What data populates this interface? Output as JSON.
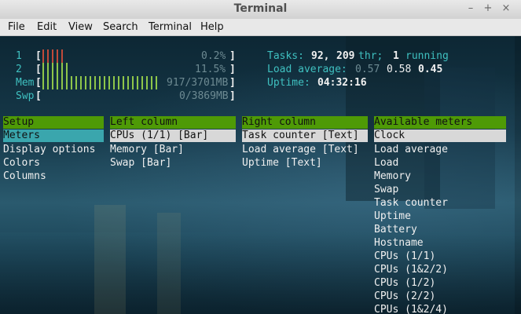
{
  "window": {
    "title": "Terminal",
    "controls": [
      "–",
      "+",
      "×"
    ]
  },
  "menu": [
    "File",
    "Edit",
    "View",
    "Search",
    "Terminal",
    "Help"
  ],
  "meters": {
    "cpu1": {
      "label": "1",
      "value": "0.2%"
    },
    "cpu2": {
      "label": "2",
      "value": "11.5%"
    },
    "mem": {
      "label": "Mem",
      "value": "917/3701MB"
    },
    "swp": {
      "label": "Swp",
      "value": "0/3869MB"
    }
  },
  "stats": {
    "tasks_label": "Tasks:",
    "tasks": "92,",
    "threads": "209",
    "thr_label": "thr;",
    "running": "1",
    "running_label": "running",
    "load_label": "Load average:",
    "load1": "0.57",
    "load5": "0.58",
    "load15": "0.45",
    "uptime_label": "Uptime:",
    "uptime": "04:32:16"
  },
  "setup": {
    "header": "Setup",
    "items": [
      "Meters",
      "Display options",
      "Colors",
      "Columns"
    ]
  },
  "left_column": {
    "header": "Left column",
    "items": [
      "CPUs (1/1) [Bar]",
      "Memory [Bar]",
      "Swap [Bar]"
    ]
  },
  "right_column": {
    "header": "Right column",
    "items": [
      "Task counter [Text]",
      "Load average [Text]",
      "Uptime [Text]"
    ]
  },
  "available_meters": {
    "header": "Available meters",
    "items": [
      "Clock",
      "Load average",
      "Load",
      "Memory",
      "Swap",
      "Task counter",
      "Uptime",
      "Battery",
      "Hostname",
      "CPUs (1/1)",
      "CPUs (1&2/2)",
      "CPUs (1/2)",
      "CPUs (2/2)",
      "CPUs (1&2/4)"
    ]
  },
  "colors": {
    "header_bg": "#4e9a06",
    "selected_teal": "#3aa6ad",
    "selected_light": "#d8d8d8",
    "accent_cyan": "#3fc0c0"
  }
}
